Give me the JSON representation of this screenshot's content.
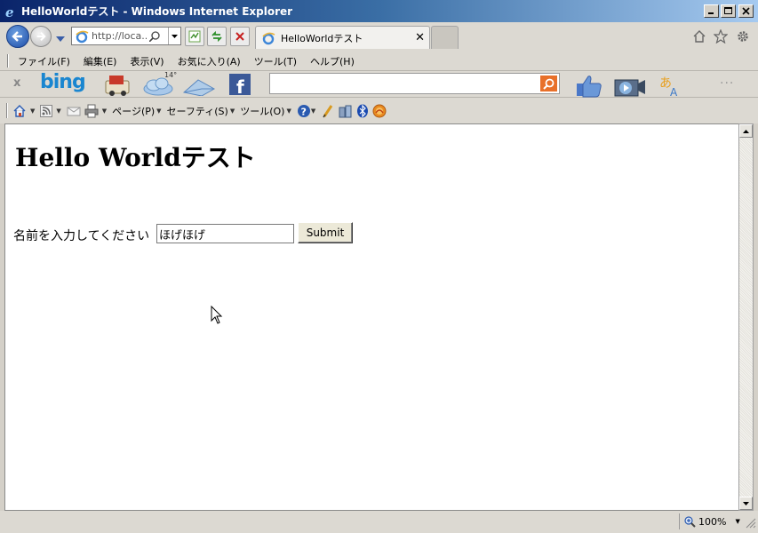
{
  "window": {
    "title": "HelloWorldテスト - Windows Internet Explorer"
  },
  "nav": {
    "address": "http://loca...",
    "tab_label": "HelloWorldテスト",
    "tab_close": "✕"
  },
  "menu": {
    "items": [
      "ファイル(F)",
      "編集(E)",
      "表示(V)",
      "お気に入り(A)",
      "ツール(T)",
      "ヘルプ(H)"
    ]
  },
  "bingbar": {
    "close": "x",
    "logo": "bing",
    "temperature": "14°",
    "search_value": "",
    "more": "···"
  },
  "command_bar": {
    "page_label": "ページ(P)",
    "safety_label": "セーフティ(S)",
    "tools_label": "ツール(O)"
  },
  "page": {
    "heading": "Hello Worldテスト",
    "form_label": "名前を入力してください",
    "name_value": "ほげほげ",
    "submit_label": "Submit"
  },
  "status": {
    "zoom": "100%"
  },
  "colors": {
    "title_bar_start": "#0a246a",
    "bing_blue": "#1a86d0",
    "bing_search_orange": "#e8702a",
    "facebook_blue": "#3b5998"
  }
}
